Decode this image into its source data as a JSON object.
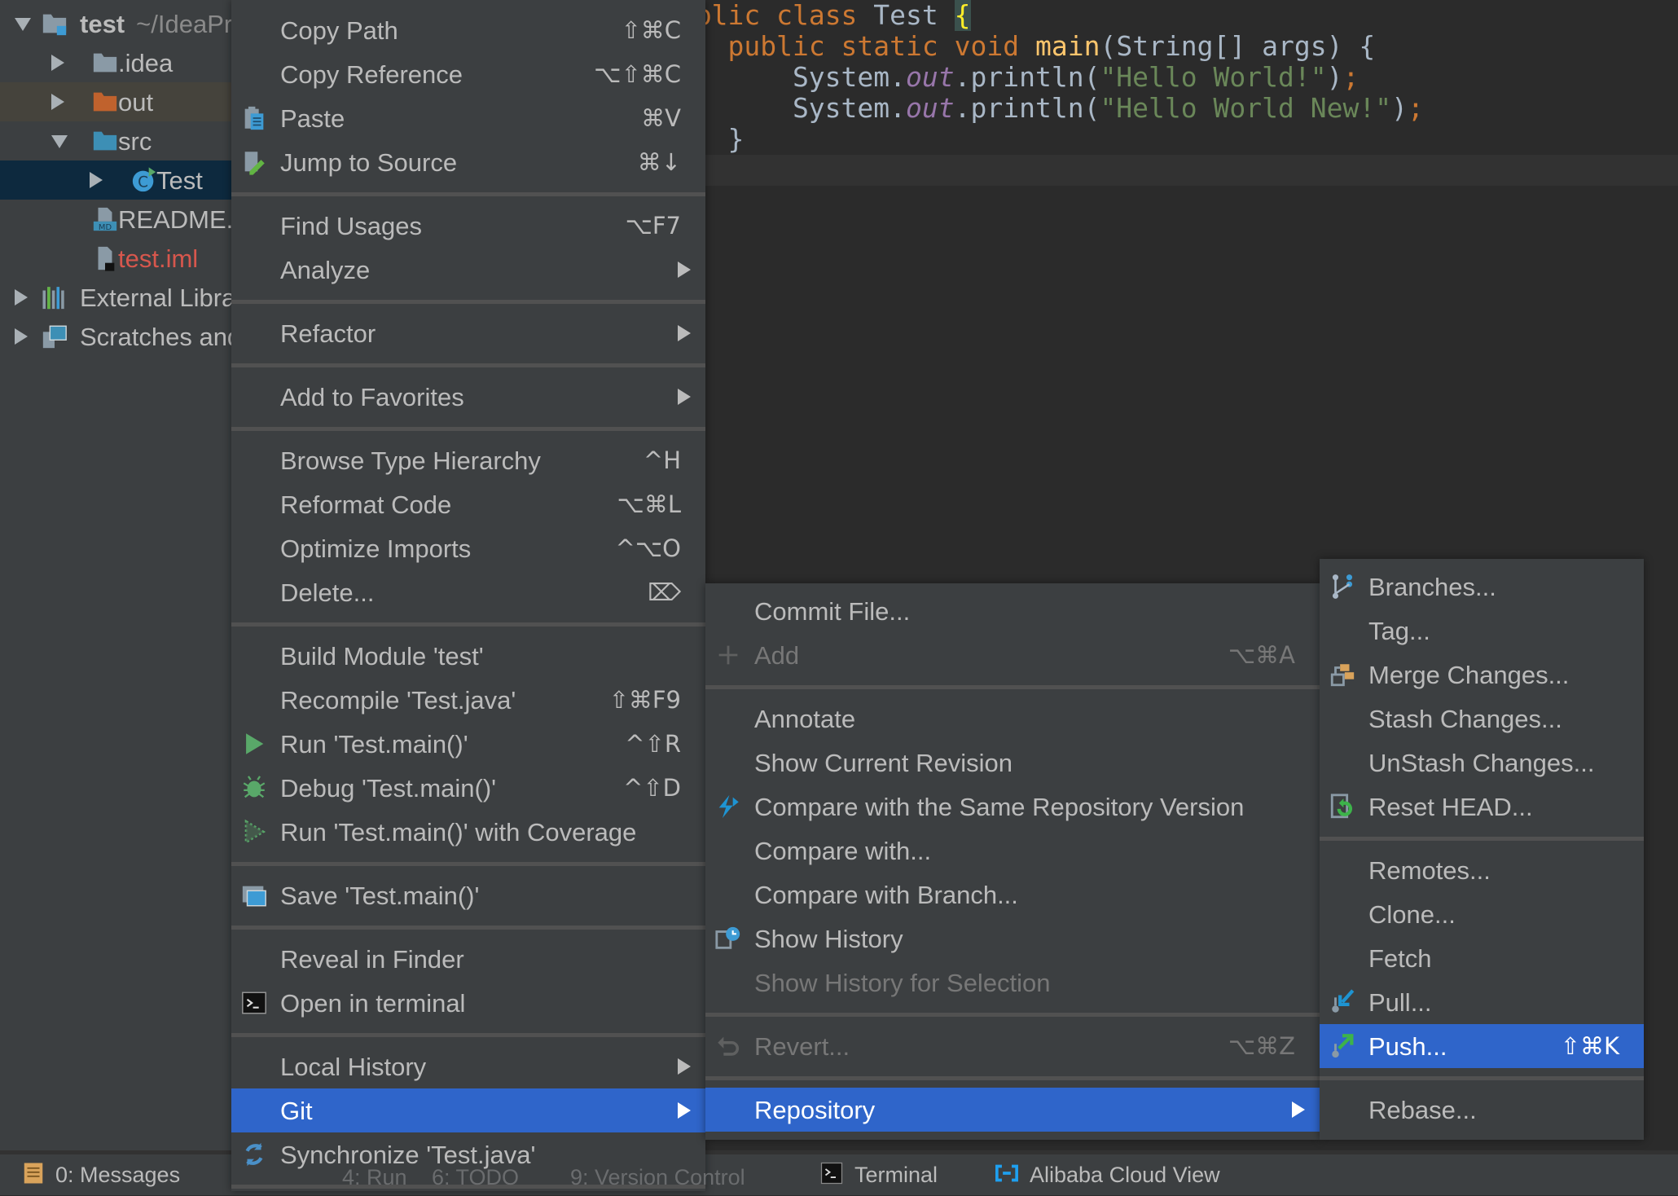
{
  "colors": {
    "highlight": "#2f65ca",
    "menu_bg": "#3c3f41",
    "menu_text": "#bbbbbb",
    "editor_bg": "#2b2b2b"
  },
  "project_tree": [
    {
      "label": "test",
      "suffix": "~/IdeaProjects/test",
      "level": 0,
      "arrow": "down",
      "icon": "module-folder-icon",
      "bold": true
    },
    {
      "label": ".idea",
      "level": 1,
      "arrow": "right",
      "icon": "folder-gray-icon"
    },
    {
      "label": "out",
      "level": 1,
      "arrow": "right",
      "icon": "folder-orange-icon",
      "highlighted": true
    },
    {
      "label": "src",
      "level": 1,
      "arrow": "down",
      "icon": "folder-blue-icon"
    },
    {
      "label": "Test",
      "level": 2,
      "arrow": "right",
      "icon": "java-class-icon",
      "selected": true
    },
    {
      "label": "README.md",
      "level": 1,
      "icon": "markdown-file-icon"
    },
    {
      "label": "test.iml",
      "level": 1,
      "icon": "iml-file-icon",
      "color": "#d7574d"
    },
    {
      "label": "External Libraries",
      "level": 0,
      "arrow": "right",
      "icon": "libraries-icon"
    },
    {
      "label": "Scratches and Consoles",
      "level": 0,
      "arrow": "right",
      "icon": "scratches-icon"
    }
  ],
  "editor": {
    "lines": [
      [
        {
          "t": "public",
          "k": "kw"
        },
        {
          "t": " class",
          "k": "kw"
        },
        {
          "t": " Test ",
          "k": "plain"
        },
        {
          "t": "{",
          "k": "brace"
        }
      ],
      [
        {
          "t": "    ",
          "k": "plain"
        },
        {
          "t": "public static void ",
          "k": "kw"
        },
        {
          "t": "main",
          "k": "fn"
        },
        {
          "t": "(String[] args) {",
          "k": "plain"
        }
      ],
      [
        {
          "t": "        System.",
          "k": "plain"
        },
        {
          "t": "out",
          "k": "field"
        },
        {
          "t": ".println(",
          "k": "plain"
        },
        {
          "t": "\"Hello World!\"",
          "k": "str"
        },
        {
          "t": ")",
          "k": "plain"
        },
        {
          "t": ";",
          "k": "kw"
        }
      ],
      [
        {
          "t": "        System.",
          "k": "plain"
        },
        {
          "t": "out",
          "k": "field"
        },
        {
          "t": ".println(",
          "k": "plain"
        },
        {
          "t": "\"Hello World New!\"",
          "k": "str"
        },
        {
          "t": ")",
          "k": "plain"
        },
        {
          "t": ";",
          "k": "kw"
        }
      ],
      [
        {
          "t": "    }",
          "k": "plain"
        }
      ]
    ]
  },
  "context_menu": [
    {
      "label": "Copy Path",
      "shortcut": "⇧⌘C"
    },
    {
      "label": "Copy Reference",
      "shortcut": "⌥⇧⌘C"
    },
    {
      "label": "Paste",
      "shortcut": "⌘V",
      "icon": "paste-icon"
    },
    {
      "label": "Jump to Source",
      "shortcut": "⌘↓",
      "icon": "jump-to-source-icon"
    },
    {
      "sep": true
    },
    {
      "label": "Find Usages",
      "shortcut": "⌥F7"
    },
    {
      "label": "Analyze",
      "submenu": true
    },
    {
      "sep": true
    },
    {
      "label": "Refactor",
      "submenu": true
    },
    {
      "sep": true
    },
    {
      "label": "Add to Favorites",
      "submenu": true
    },
    {
      "sep": true
    },
    {
      "label": "Browse Type Hierarchy",
      "shortcut": "^H"
    },
    {
      "label": "Reformat Code",
      "shortcut": "⌥⌘L"
    },
    {
      "label": "Optimize Imports",
      "shortcut": "^⌥O"
    },
    {
      "label": "Delete...",
      "shortcut": "⌦"
    },
    {
      "sep": true
    },
    {
      "label": "Build Module 'test'"
    },
    {
      "label": "Recompile 'Test.java'",
      "shortcut": "⇧⌘F9"
    },
    {
      "label": "Run 'Test.main()'",
      "shortcut": "^⇧R",
      "icon": "run-icon"
    },
    {
      "label": "Debug 'Test.main()'",
      "shortcut": "^⇧D",
      "icon": "debug-icon"
    },
    {
      "label": "Run 'Test.main()' with Coverage",
      "icon": "coverage-icon"
    },
    {
      "sep": true
    },
    {
      "label": "Save 'Test.main()'",
      "icon": "save-icon"
    },
    {
      "sep": true
    },
    {
      "label": "Reveal in Finder"
    },
    {
      "label": "Open in terminal",
      "icon": "terminal-icon"
    },
    {
      "sep": true
    },
    {
      "label": "Local History",
      "submenu": true
    },
    {
      "label": "Git",
      "submenu": true,
      "active": true
    },
    {
      "label": "Synchronize 'Test.java'",
      "icon": "sync-icon"
    },
    {
      "sep": true
    }
  ],
  "git_menu": [
    {
      "label": "Commit File..."
    },
    {
      "label": "Add",
      "shortcut": "⌥⌘A",
      "icon": "add-icon",
      "disabled": true
    },
    {
      "sep": true
    },
    {
      "label": "Annotate"
    },
    {
      "label": "Show Current Revision"
    },
    {
      "label": "Compare with the Same Repository Version",
      "icon": "compare-icon"
    },
    {
      "label": "Compare with..."
    },
    {
      "label": "Compare with Branch..."
    },
    {
      "label": "Show History",
      "icon": "history-icon"
    },
    {
      "label": "Show History for Selection",
      "disabled": true
    },
    {
      "sep": true
    },
    {
      "label": "Revert...",
      "shortcut": "⌥⌘Z",
      "icon": "revert-icon",
      "disabled": true
    },
    {
      "sep": true
    },
    {
      "label": "Repository",
      "submenu": true,
      "active": true
    }
  ],
  "repository_menu": [
    {
      "label": "Branches...",
      "icon": "branches-icon"
    },
    {
      "label": "Tag..."
    },
    {
      "label": "Merge Changes...",
      "icon": "merge-icon"
    },
    {
      "label": "Stash Changes..."
    },
    {
      "label": "UnStash Changes..."
    },
    {
      "label": "Reset HEAD...",
      "icon": "reset-icon"
    },
    {
      "sep": true
    },
    {
      "label": "Remotes..."
    },
    {
      "label": "Clone..."
    },
    {
      "label": "Fetch"
    },
    {
      "label": "Pull...",
      "icon": "pull-icon"
    },
    {
      "label": "Push...",
      "shortcut": "⇧⌘K",
      "icon": "push-icon",
      "active": true
    },
    {
      "sep": true
    },
    {
      "label": "Rebase..."
    }
  ],
  "status_bar": {
    "messages": "0: Messages",
    "run": "4: Run",
    "todo": "6: TODO",
    "version_control": "9: Version Control",
    "terminal": "Terminal",
    "alibaba": "Alibaba Cloud View"
  }
}
